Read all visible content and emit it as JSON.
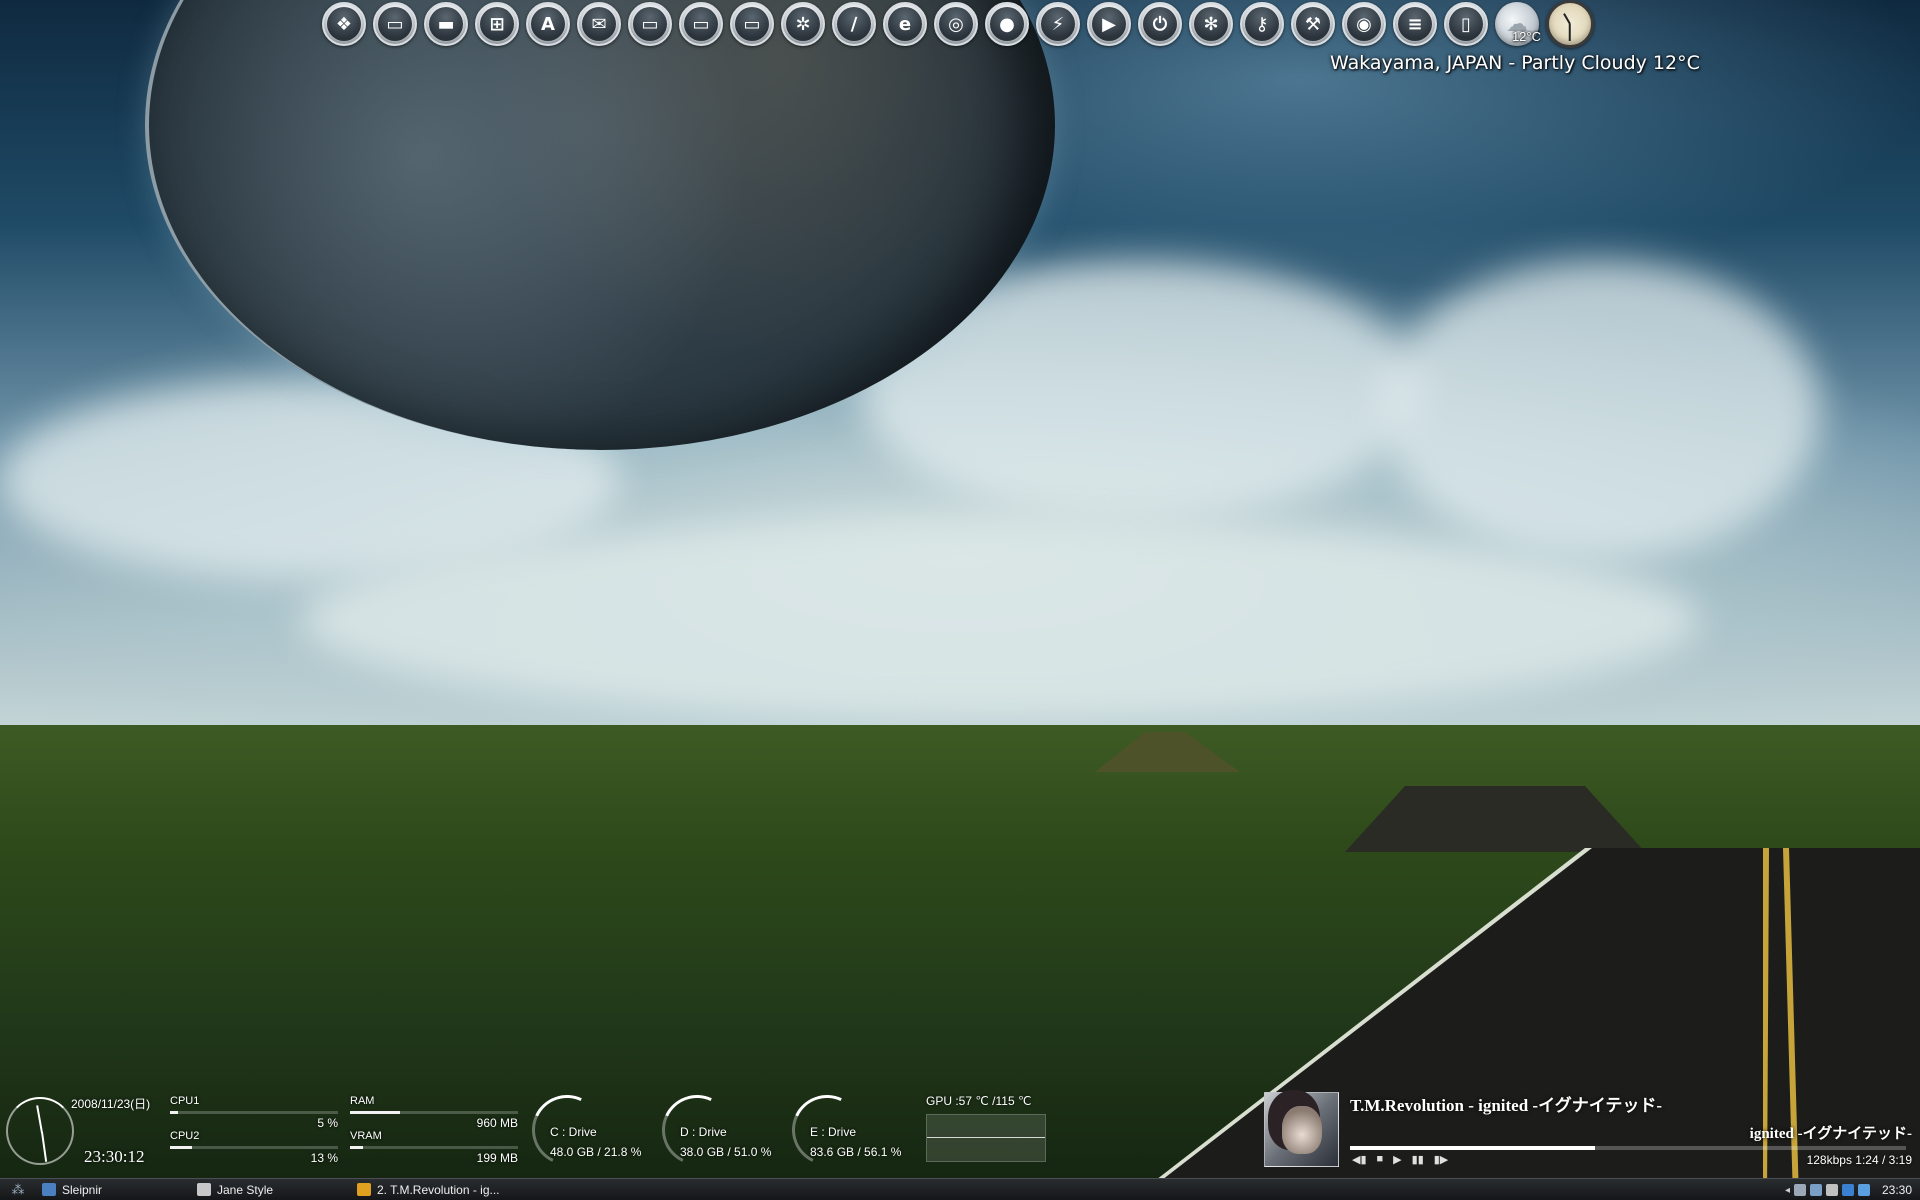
{
  "dock": {
    "items": [
      {
        "name": "windows-icon",
        "glyph": "❖"
      },
      {
        "name": "monitor-icon",
        "glyph": "▭"
      },
      {
        "name": "folder-icon",
        "glyph": "▬"
      },
      {
        "name": "network-icon",
        "glyph": "⊞"
      },
      {
        "name": "font-icon",
        "glyph": "A"
      },
      {
        "name": "mail-icon",
        "glyph": "✉"
      },
      {
        "name": "drive-icon",
        "glyph": "▭"
      },
      {
        "name": "drive-icon",
        "glyph": "▭"
      },
      {
        "name": "drive-icon",
        "glyph": "▭"
      },
      {
        "name": "settings-wheel-icon",
        "glyph": "✲"
      },
      {
        "name": "pen-icon",
        "glyph": "∕"
      },
      {
        "name": "internet-explorer-icon",
        "glyph": "e"
      },
      {
        "name": "firefox-icon",
        "glyph": "◎"
      },
      {
        "name": "apple-icon",
        "glyph": "●"
      },
      {
        "name": "lightning-icon",
        "glyph": "⚡"
      },
      {
        "name": "play-icon",
        "glyph": "▶"
      },
      {
        "name": "power-icon",
        "glyph": "⏻"
      },
      {
        "name": "snowflake-icon",
        "glyph": "✻"
      },
      {
        "name": "key-icon",
        "glyph": "⚷"
      },
      {
        "name": "hammer-icon",
        "glyph": "⚒"
      },
      {
        "name": "speaker-icon",
        "glyph": "◉"
      },
      {
        "name": "list-icon",
        "glyph": "≡"
      },
      {
        "name": "trash-icon",
        "glyph": "▯"
      }
    ],
    "weather_temp": "12°C"
  },
  "weather": {
    "text": "Wakayama, JAPAN - Partly Cloudy 12°C"
  },
  "sysmon": {
    "date": "2008/11/23(日)",
    "time": "23:30:12",
    "cpu1": {
      "label": "CPU1",
      "value": "5 %",
      "percent": 5
    },
    "cpu2": {
      "label": "CPU2",
      "value": "13 %",
      "percent": 13
    },
    "ram": {
      "label": "RAM",
      "value": "960 MB",
      "percent": 30
    },
    "vram": {
      "label": "VRAM",
      "value": "199 MB",
      "percent": 8
    },
    "drives": [
      {
        "name": "C : Drive",
        "value": "48.0 GB  /  21.8 %"
      },
      {
        "name": "D : Drive",
        "value": "38.0 GB  /  51.0 %"
      },
      {
        "name": "E : Drive",
        "value": "83.6 GB  /  56.1 %"
      }
    ],
    "gpu": {
      "label": "GPU :57 ℃ /115 ℃"
    }
  },
  "player": {
    "title": "T.M.Revolution - ignited -イグナイテッド-",
    "subtitle": "ignited -イグナイテッド-",
    "progress": 0.44,
    "bitrate": "128kbps   1:24 / 3:19",
    "controls": [
      "◀▮",
      "■",
      "▶",
      "▮▮",
      "▮▶"
    ]
  },
  "taskbar": {
    "items": [
      {
        "label": "Sleipnir",
        "color": "#4a7fc0"
      },
      {
        "label": "Jane Style",
        "color": "#c8c8c8"
      },
      {
        "label": "2. T.M.Revolution - ig...",
        "color": "#e0a020"
      }
    ],
    "clock": "23:30",
    "tray_colors": [
      "#9aa8b8",
      "#7aa0c8",
      "#c0c0c0",
      "#3a80d0",
      "#5aa0e0"
    ]
  }
}
